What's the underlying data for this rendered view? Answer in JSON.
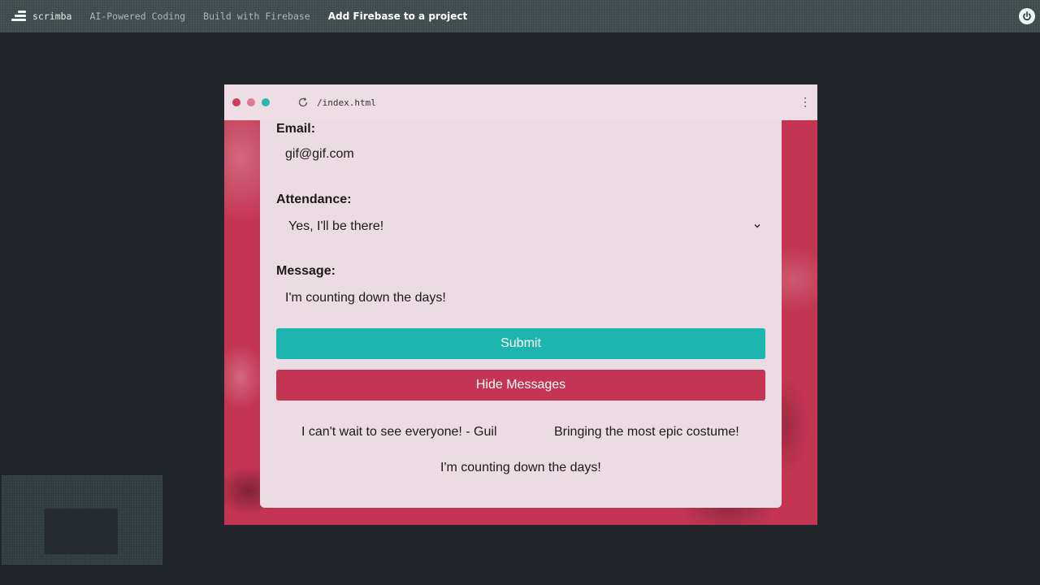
{
  "topbar": {
    "brand": "scrimba",
    "breadcrumbs": [
      "AI-Powered Coding",
      "Build with Firebase",
      "Add Firebase to a project"
    ]
  },
  "preview": {
    "url": "/index.html",
    "form": {
      "email_label": "Email:",
      "email_value": "gif@gif.com",
      "attendance_label": "Attendance:",
      "attendance_value": "Yes, I'll be there!",
      "message_label": "Message:",
      "message_value": "I'm counting down the days!",
      "submit_label": "Submit",
      "hide_label": "Hide Messages"
    },
    "messages": [
      "I can't wait to see everyone! - Guil",
      "Bringing the most epic costume!",
      "I'm counting down the days!"
    ]
  },
  "colors": {
    "submit": "#1db6ae",
    "hide": "#c33553",
    "card": "#ebdbe2",
    "background": "#22262b"
  },
  "icons": [
    "scrimba-logo-icon",
    "power-icon",
    "reload-icon",
    "kebab-menu-icon",
    "chevron-down-icon"
  ]
}
